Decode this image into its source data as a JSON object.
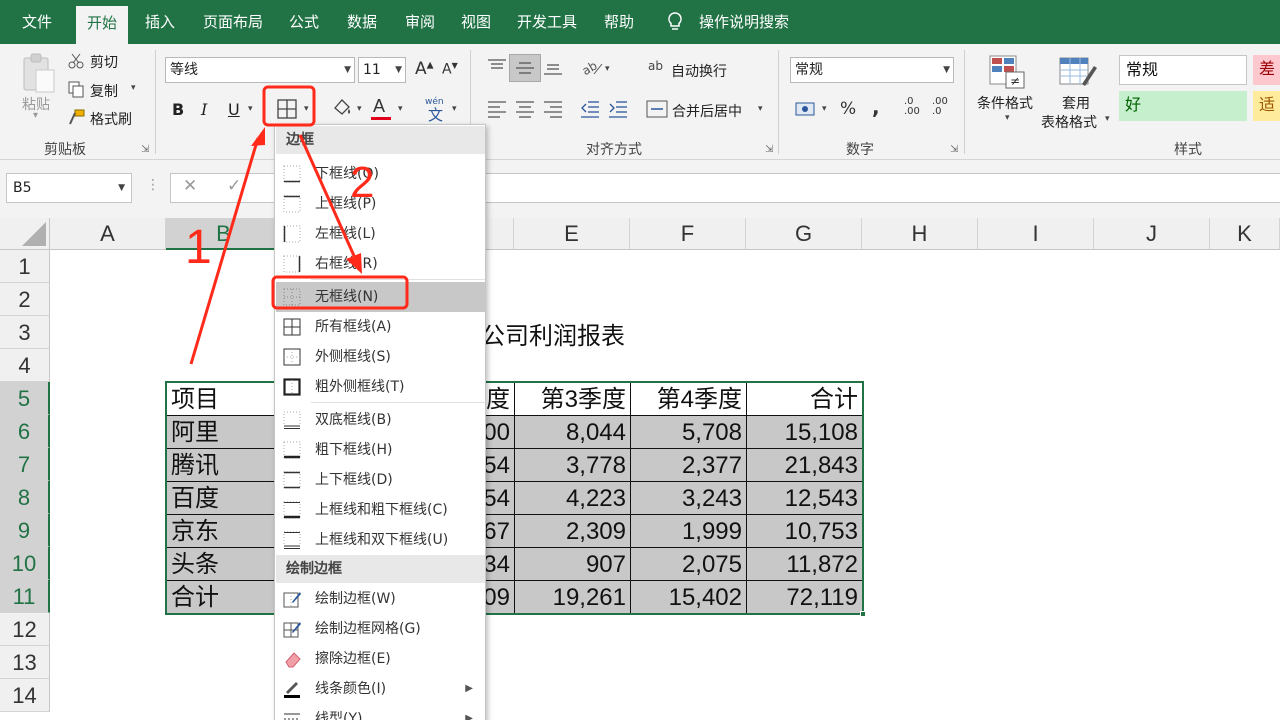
{
  "menubar": {
    "tabs": [
      "文件",
      "开始",
      "插入",
      "页面布局",
      "公式",
      "数据",
      "审阅",
      "视图",
      "开发工具",
      "帮助"
    ],
    "active_tab": "开始",
    "search_label": "操作说明搜索"
  },
  "ribbon": {
    "clipboard": {
      "paste": "粘贴",
      "cut": "剪切",
      "copy": "复制",
      "format_painter": "格式刷",
      "group": "剪贴板"
    },
    "font": {
      "name": "等线",
      "size": "11",
      "bold": "B",
      "italic": "I",
      "underline": "U",
      "font_color_glyph": "A",
      "phonetic": "wén"
    },
    "alignment": {
      "wrap_text": "自动换行",
      "merge_center": "合并后居中",
      "group": "对齐方式",
      "abc": "ab"
    },
    "number": {
      "format": "常规",
      "percent": "%",
      "comma": ",",
      "group": "数字",
      "inc_decimal": ".00",
      "dec_decimal": ".0"
    },
    "styles": {
      "conditional": "条件格式",
      "table_fmt_1": "套用",
      "table_fmt_2": "表格格式",
      "normal": "常规",
      "bad": "差",
      "good": "好",
      "neutral": "适",
      "group": "样式"
    }
  },
  "formula_bar": {
    "name_box": "B5",
    "cancel": "✕",
    "enter": "✓"
  },
  "sheet": {
    "columns": [
      "A",
      "B",
      "C",
      "D",
      "E",
      "F",
      "G",
      "H",
      "I",
      "J",
      "K"
    ],
    "rows": [
      "1",
      "2",
      "3",
      "4",
      "5",
      "6",
      "7",
      "8",
      "9",
      "10",
      "11",
      "12",
      "13",
      "14"
    ],
    "selected_col": "B",
    "title_fragment": "公司利润报表",
    "table": {
      "header": [
        "项目",
        "度",
        "第3季度",
        "第4季度",
        "合计"
      ],
      "rows": [
        [
          "阿里",
          "00",
          "8,044",
          "5,708",
          "15,108"
        ],
        [
          "腾讯",
          "54",
          "3,778",
          "2,377",
          "21,843"
        ],
        [
          "百度",
          "54",
          "4,223",
          "3,243",
          "12,543"
        ],
        [
          "京东",
          "67",
          "2,309",
          "1,999",
          "10,753"
        ],
        [
          "头条",
          "34",
          "907",
          "2,075",
          "11,872"
        ],
        [
          "合计",
          "09",
          "19,261",
          "15,402",
          "72,119"
        ]
      ]
    }
  },
  "border_menu": {
    "section_border": "边框",
    "items": [
      {
        "label": "下框线(O)",
        "icon": "border-bottom-icon"
      },
      {
        "label": "上框线(P)",
        "icon": "border-top-icon"
      },
      {
        "label": "左框线(L)",
        "icon": "border-left-icon"
      },
      {
        "label": "右框线(R)",
        "icon": "border-right-icon"
      },
      {
        "label": "无框线(N)",
        "icon": "no-border-icon"
      },
      {
        "label": "所有框线(A)",
        "icon": "all-borders-icon"
      },
      {
        "label": "外侧框线(S)",
        "icon": "outside-borders-icon"
      },
      {
        "label": "粗外侧框线(T)",
        "icon": "thick-outside-borders-icon"
      },
      {
        "label": "双底框线(B)",
        "icon": "bottom-double-border-icon"
      },
      {
        "label": "粗下框线(H)",
        "icon": "thick-bottom-border-icon"
      },
      {
        "label": "上下框线(D)",
        "icon": "top-bottom-border-icon"
      },
      {
        "label": "上框线和粗下框线(C)",
        "icon": "top-thick-bottom-border-icon"
      },
      {
        "label": "上框线和双下框线(U)",
        "icon": "top-double-bottom-border-icon"
      }
    ],
    "section_draw": "绘制边框",
    "draw_items": [
      {
        "label": "绘制边框(W)",
        "icon": "draw-border-icon"
      },
      {
        "label": "绘制边框网格(G)",
        "icon": "draw-border-grid-icon"
      },
      {
        "label": "擦除边框(E)",
        "icon": "eraser-icon"
      },
      {
        "label": "线条颜色(I)",
        "icon": "line-color-icon"
      },
      {
        "label": "线型(Y)",
        "icon": "line-style-icon"
      }
    ],
    "highlighted": "无框线(N)"
  },
  "annotations": {
    "step1": "1",
    "step2": "2",
    "color": "#ff2a1a"
  },
  "colors": {
    "excel_green": "#217346",
    "selection_fill": "#c8c8c8"
  }
}
